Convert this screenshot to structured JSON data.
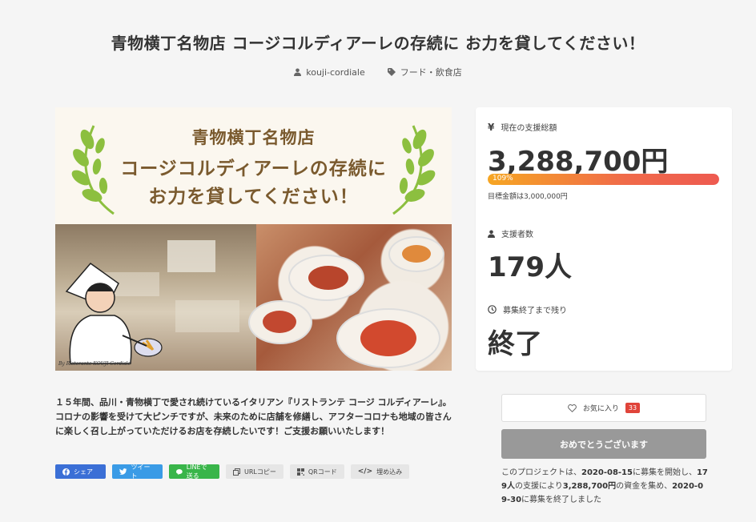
{
  "page": {
    "title": "青物横丁名物店 コージコルディアーレの存続に お力を貸してください！",
    "owner": "kouji-cordiale",
    "category": "フード・飲食店"
  },
  "hero": {
    "banner_line1": "青物横丁名物店",
    "banner_line2": "コージコルディアーレの存続に",
    "banner_line3": "お力を貸してください！",
    "signature": "By Ristorante KOUJI Cordiale"
  },
  "stats": {
    "total_label": "現在の支援総額",
    "total_amount": "3,288,700円",
    "progress_percent": 109,
    "progress_text": "109%",
    "goal_text": "目標金額は3,000,000円",
    "backers_label": "支援者数",
    "backers_value": "179人",
    "remaining_label": "募集終了まで残り",
    "remaining_value": "終了"
  },
  "description": "１５年間、品川・青物横丁で愛され続けているイタリアン『リストランテ コージ コルディアーレ』。コロナの影響を受けて大ピンチですが、未来のために店舗を修繕し、アフターコロナも地域の皆さんに楽しく召し上がっていただけるお店を存続したいです！ご支援お願いいたします！",
  "share": {
    "facebook": "シェア",
    "twitter": "ツイート",
    "line": "LINEで送る",
    "url_copy": "URLコピー",
    "qr_code": "QRコード",
    "embed": "埋め込み"
  },
  "actions": {
    "favorite_label": "お気に入り",
    "favorite_count": "33",
    "congrats_label": "おめでとうございます"
  },
  "summary": {
    "prefix": "このプロジェクトは、",
    "start_date": "2020-08-15",
    "mid1": "に募集を開始し、",
    "backers": "179人",
    "mid2": "の支援により",
    "amount": "3,288,700円",
    "mid3": "の資金を集め、",
    "end_date": "2020-09-30",
    "suffix": "に募集を終了しました"
  },
  "colors": {
    "accent_progress_start": "#f6a623",
    "accent_progress_end": "#ee5a50",
    "facebook": "#3b6fd6",
    "twitter": "#3a9be6",
    "line": "#39b54a",
    "badge": "#e0443a"
  },
  "icons": {
    "owner": "user-icon",
    "category": "tag-icon",
    "total": "yen-icon",
    "backers": "person-icon",
    "remaining": "clock-icon",
    "favorite": "heart-icon"
  }
}
